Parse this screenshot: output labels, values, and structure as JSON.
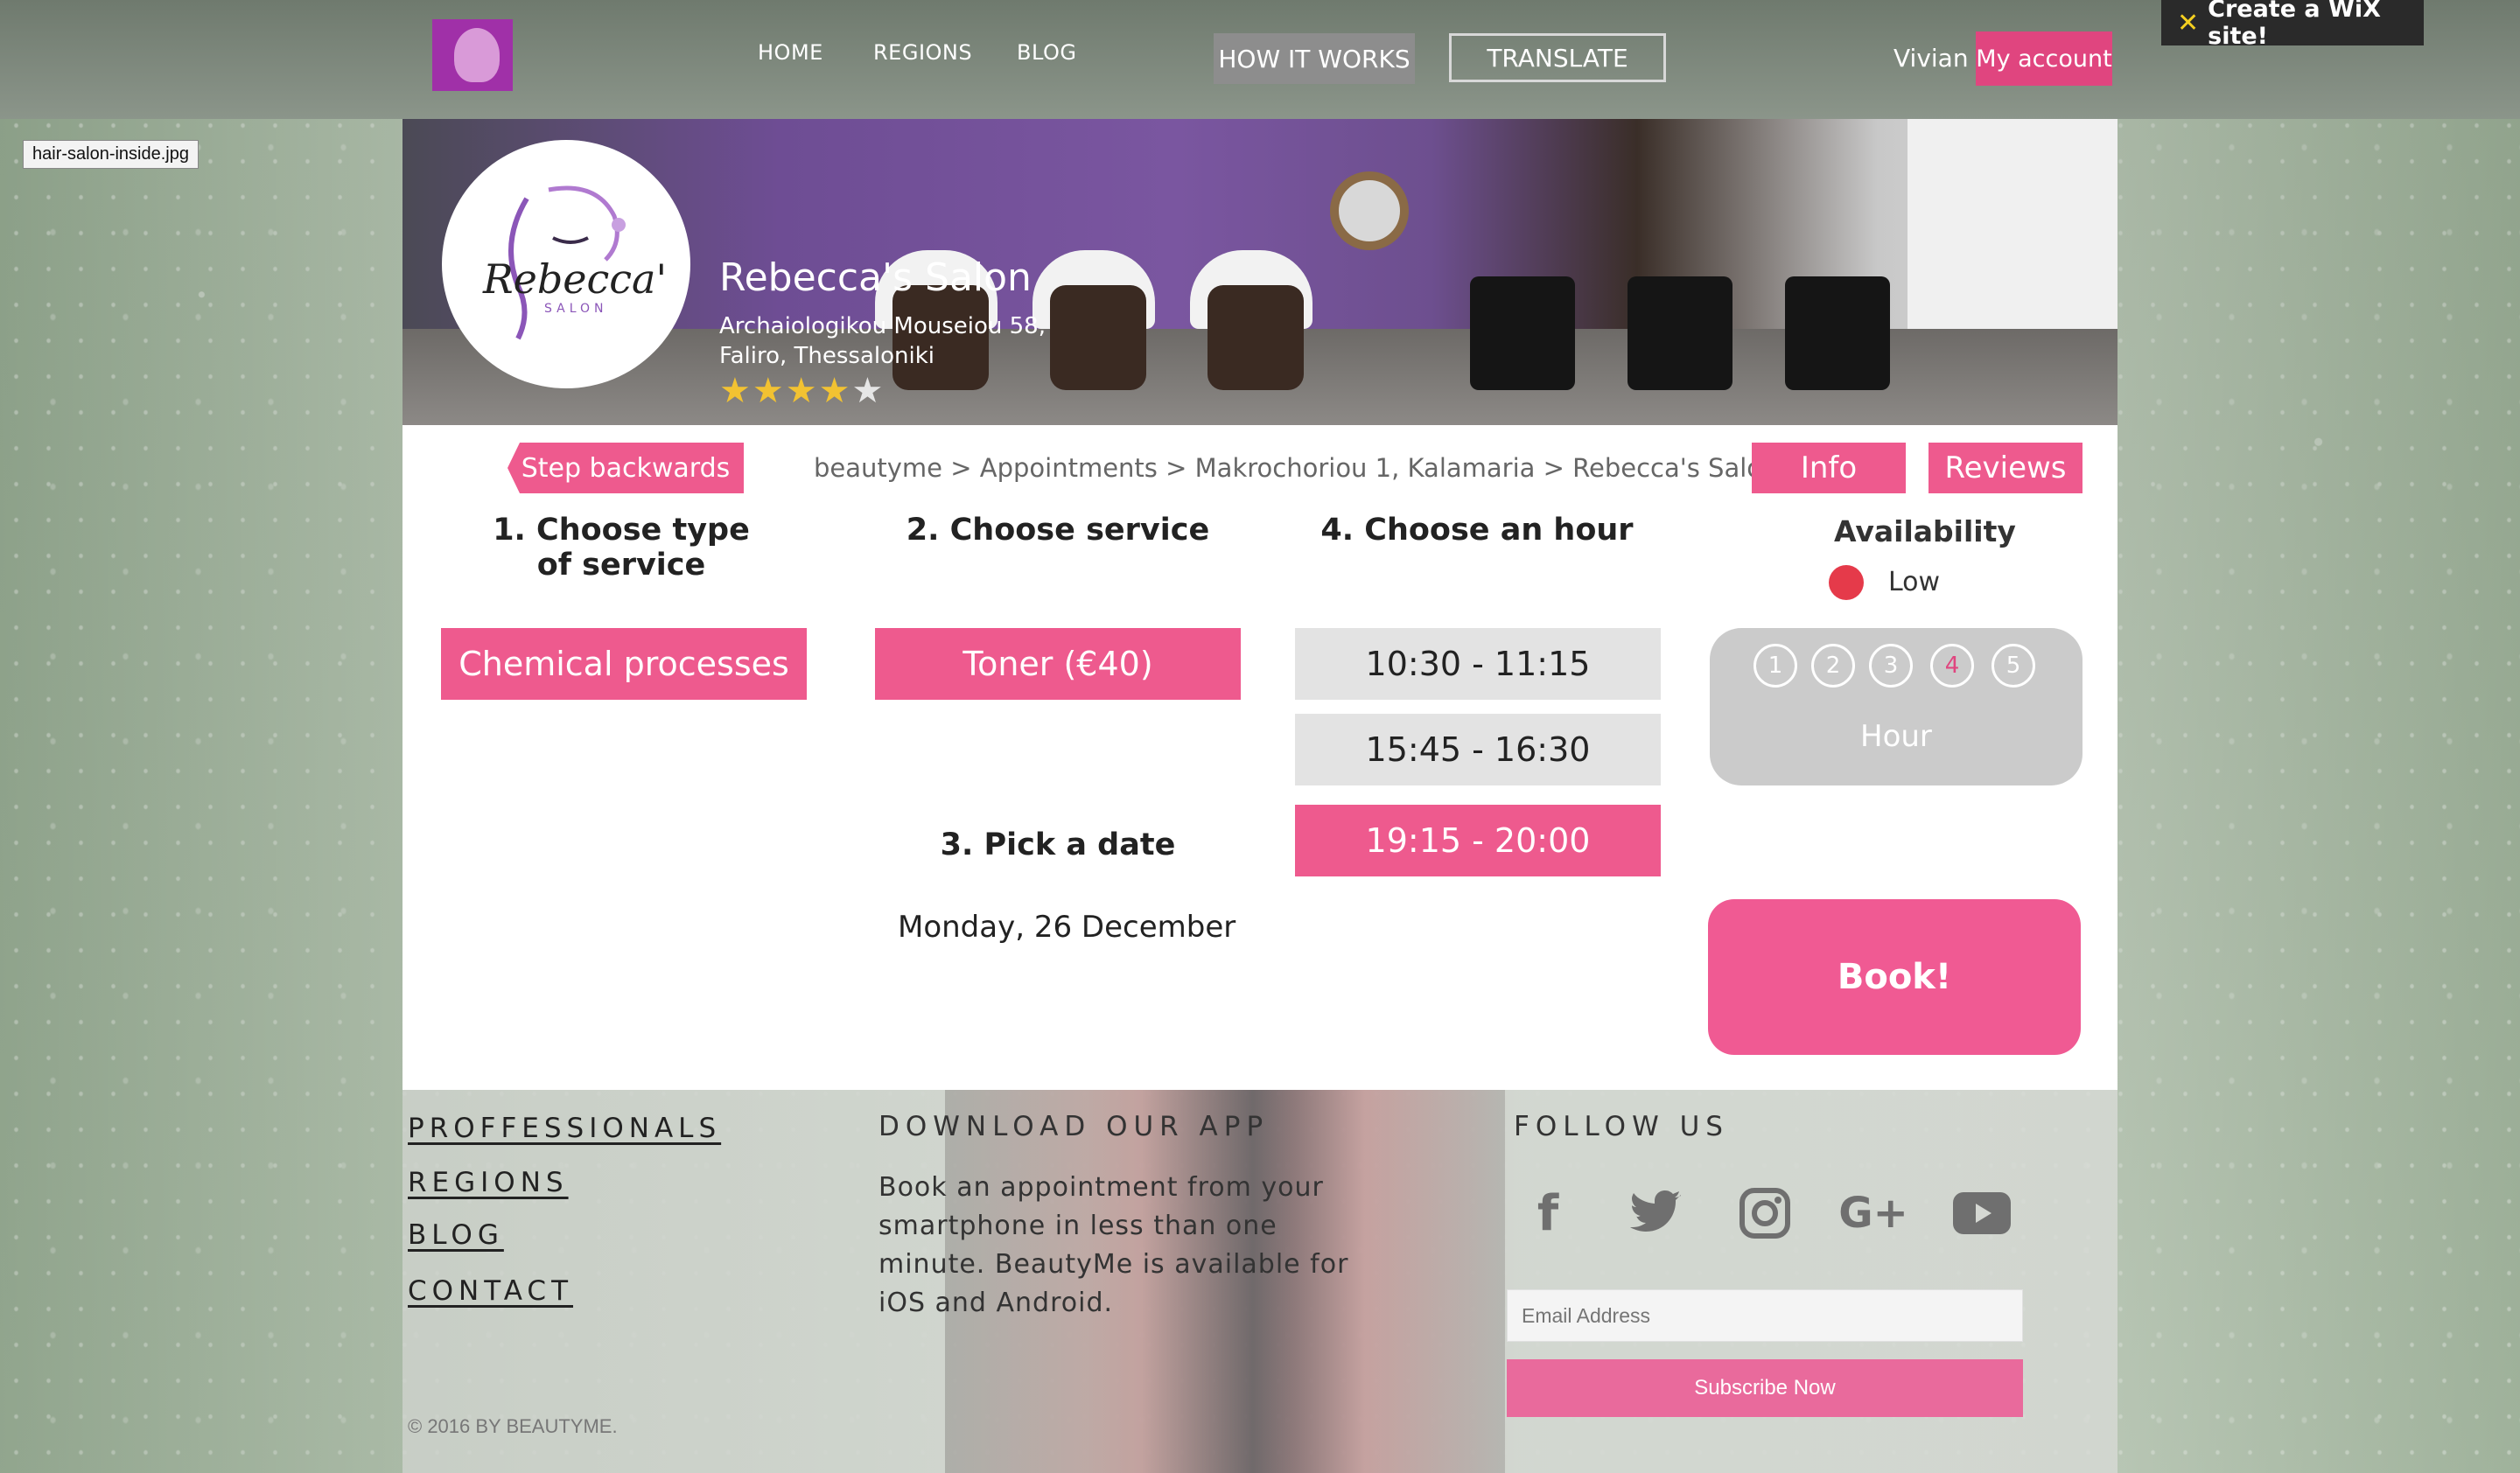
{
  "header": {
    "nav": [
      "HOME",
      "REGIONS",
      "BLOG"
    ],
    "how_it_works": "HOW IT WORKS",
    "translate": "TRANSLATE",
    "user_name": "Vivian",
    "my_account": "My account",
    "wix_badge": "Create a WiX site!",
    "file_tag": "hair-salon-inside.jpg"
  },
  "salon": {
    "name": "Rebecca's Salon",
    "address_line1": "Archaiologikou Mouseiou 58,",
    "address_line2": "Faliro, Thessaloniki",
    "rating": 3.5,
    "rating_max": 5,
    "logo_text": "Rebecca's",
    "logo_sub": "SALON"
  },
  "booking": {
    "back_label": "Step backwards",
    "breadcrumb": "beautyme > Appointments > Makrochoriou 1, Kalamaria > Rebecca's Salon",
    "info_label": "Info",
    "reviews_label": "Reviews",
    "step1_line1": "1. Choose type",
    "step1_line2": "of service",
    "step2": "2. Choose service",
    "step3": "3. Pick a date",
    "step4": "4. Choose an hour",
    "service_type": "Chemical processes",
    "service": "Toner (€40)",
    "date": "Monday, 26 December",
    "hours": [
      {
        "label": "10:30 - 11:15",
        "selected": false
      },
      {
        "label": "15:45 - 16:30",
        "selected": false
      },
      {
        "label": "19:15 - 20:00",
        "selected": true
      }
    ],
    "availability_title": "Availability",
    "availability_level": "Low",
    "availability_color": "#e53a4a",
    "progress_steps": [
      "1",
      "2",
      "3",
      "4",
      "5"
    ],
    "progress_active": 4,
    "progress_label": "Hour",
    "book_label": "Book!",
    "accent_color": "#ee5a8e"
  },
  "footer": {
    "links": [
      "PROFFESSIONALS",
      "REGIONS",
      "BLOG",
      "CONTACT"
    ],
    "app_heading": "DOWNLOAD OUR APP",
    "app_text": "Book an appointment from your smartphone in less than one minute. BeautyMe is available for iOS and Android.",
    "follow_heading": "FOLLOW US",
    "social_icons": [
      "facebook-icon",
      "twitter-icon",
      "instagram-icon",
      "google-plus-icon",
      "youtube-icon"
    ],
    "email_placeholder": "Email Address",
    "subscribe_label": "Subscribe Now",
    "copyright": "© 2016 BY BEAUTYME."
  }
}
